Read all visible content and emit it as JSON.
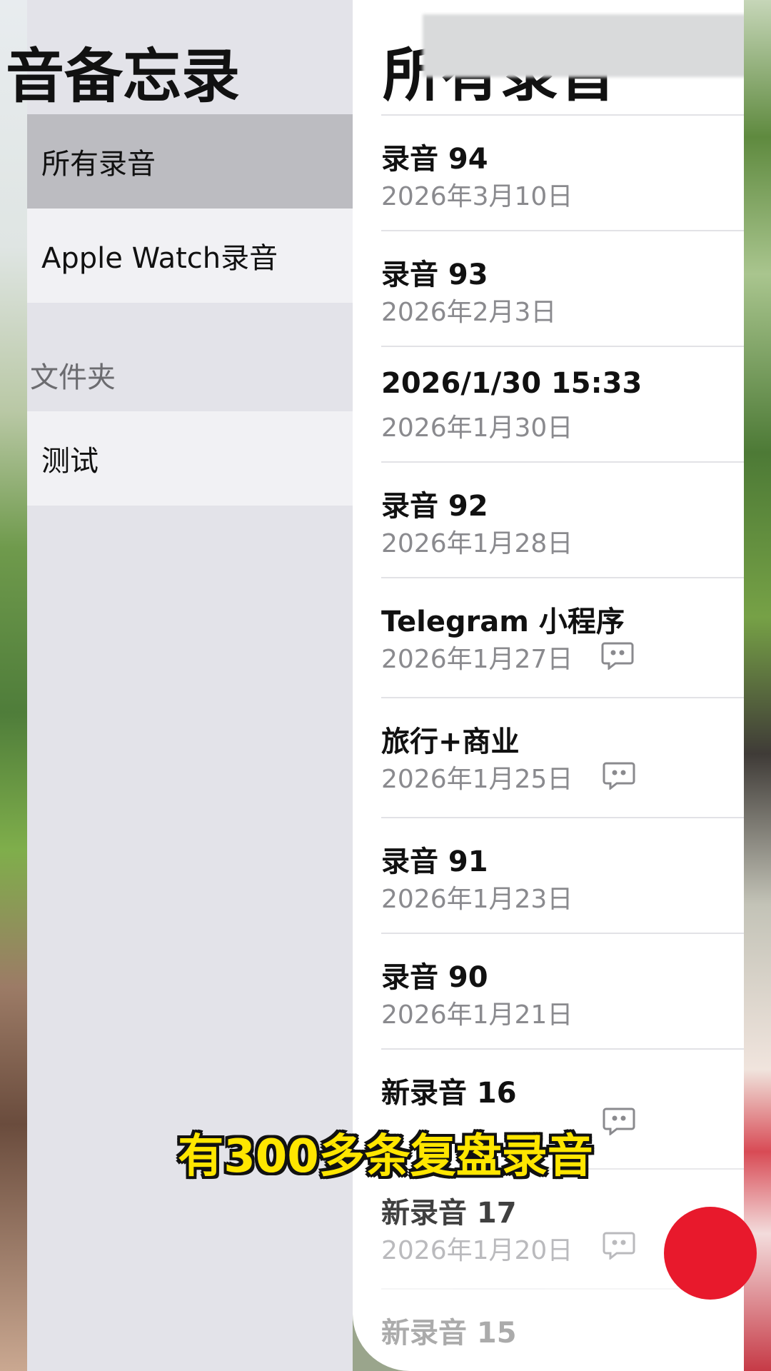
{
  "sidebar": {
    "title": "音备忘录",
    "items": [
      {
        "label": "所有录音"
      },
      {
        "label": "Apple Watch录音"
      }
    ],
    "section_header": "文件夹",
    "folders": [
      {
        "label": "测试"
      }
    ]
  },
  "main": {
    "title": "所有录音",
    "recordings": [
      {
        "title": "录音 94",
        "date": "2026年3月10日",
        "has_transcript": false
      },
      {
        "title": "录音 93",
        "date": "2026年2月3日",
        "has_transcript": false
      },
      {
        "title": "2026/1/30 15:33",
        "date": "2026年1月30日",
        "has_transcript": false
      },
      {
        "title": "录音 92",
        "date": "2026年1月28日",
        "has_transcript": false
      },
      {
        "title": "Telegram 小程序",
        "date": "2026年1月27日",
        "has_transcript": true
      },
      {
        "title": "旅行+商业",
        "date": "2026年1月25日",
        "has_transcript": true
      },
      {
        "title": "录音 91",
        "date": "2026年1月23日",
        "has_transcript": false
      },
      {
        "title": "录音 90",
        "date": "2026年1月21日",
        "has_transcript": false
      },
      {
        "title": "新录音 16",
        "date": "",
        "has_transcript": true
      },
      {
        "title": "新录音 17",
        "date": "2026年1月20日",
        "has_transcript": true
      },
      {
        "title": "新录音 15",
        "date": "",
        "has_transcript": false
      }
    ]
  },
  "caption": "有300多条复盘录音",
  "colors": {
    "record_button": "#e8192c",
    "caption_text": "#ffe600"
  },
  "icons": {
    "transcript": "quote-bubble-icon"
  }
}
